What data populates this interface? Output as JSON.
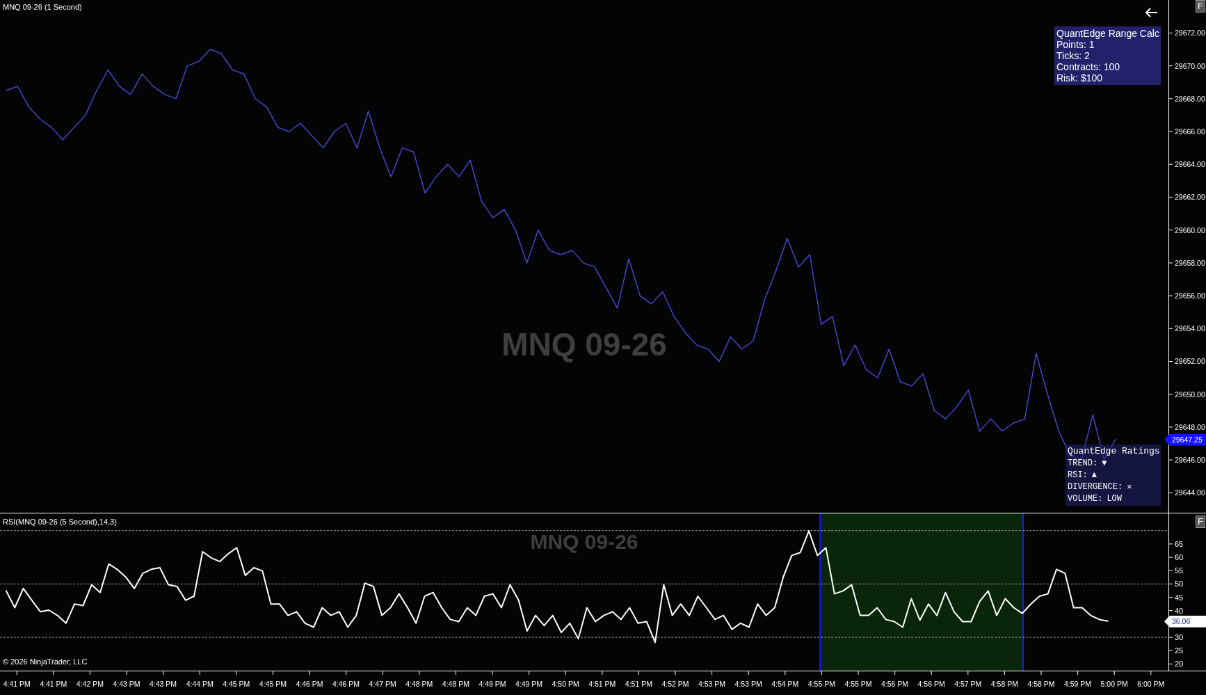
{
  "price_panel": {
    "title": "MNQ 09-26 (1 Second)",
    "watermark": "MNQ 09-26",
    "corner_button": "F",
    "current_price": "29647.25",
    "range_calc": {
      "title": "QuantEdge Range Calc",
      "lines": [
        "Points: 1",
        "Ticks: 2",
        "Contracts: 100",
        "Risk: $100"
      ]
    },
    "ratings": {
      "title": "QuantEdge Ratings",
      "rows": [
        {
          "label": "TREND:",
          "value": "▼"
        },
        {
          "label": "RSI:",
          "value": "▲"
        },
        {
          "label": "DIVERGENCE:",
          "value": "✕"
        },
        {
          "label": "VOLUME:",
          "value": "LOW"
        }
      ]
    },
    "chart_data": {
      "type": "line",
      "ylim": [
        29642.74,
        29674.01
      ],
      "categories": [
        null,
        null,
        null,
        null,
        null,
        null,
        null,
        null,
        null,
        null,
        null,
        null,
        null,
        null,
        null,
        null,
        null,
        null,
        null,
        null,
        null,
        null,
        null,
        null,
        null,
        null,
        null,
        null,
        null,
        null,
        null,
        null,
        null,
        null,
        null,
        null,
        null,
        null,
        null,
        null,
        null,
        null,
        null,
        null,
        null,
        null,
        null,
        null,
        null,
        null,
        null,
        null,
        null,
        null,
        null,
        null,
        null,
        null,
        null,
        null,
        null,
        null,
        null,
        null,
        null,
        null,
        null,
        null,
        null,
        null,
        null,
        null,
        null,
        null,
        null,
        null,
        null,
        null,
        null,
        null,
        null,
        null,
        null,
        null,
        null,
        null,
        null,
        null,
        null,
        null,
        null,
        null,
        null,
        null,
        null,
        null,
        null,
        null,
        null
      ],
      "series": [
        {
          "color": "#4b48d6",
          "values": [
            29668.5,
            29668.75,
            29667.5,
            29666.75,
            29666.25,
            29665.5,
            29666.25,
            29667,
            29668.5,
            29669.75,
            29668.75,
            29668.25,
            29669.5,
            29668.75,
            29668.25,
            29668,
            29670,
            29670.25,
            29671,
            29670.75,
            29669.75,
            29669.5,
            29668,
            29667.5,
            29666.25,
            29666,
            29666.5,
            29665.75,
            29665,
            29666,
            29666.5,
            29665,
            29667.25,
            29665,
            29663.25,
            29665,
            29664.75,
            29662.25,
            29663.25,
            29664,
            29663.25,
            29664.25,
            29661.75,
            29660.75,
            29661.25,
            29660,
            29658,
            29660,
            29658.75,
            29658.5,
            29658.75,
            29658,
            29657.75,
            29656.5,
            29655.25,
            29658.25,
            29656,
            29655.5,
            29656.25,
            29654.75,
            29653.75,
            29653,
            29652.75,
            29652,
            29653.5,
            29652.75,
            29653.25,
            29655.75,
            29657.5,
            29659.5,
            29657.75,
            29658.5,
            29654.25,
            29654.75,
            29651.75,
            29653,
            29651.5,
            29651,
            29652.75,
            29650.75,
            29650.5,
            29651.25,
            29649,
            29648.5,
            29649.25,
            29650.25,
            29647.75,
            29648.5,
            29647.75,
            29648.25,
            29648.5,
            29652.5,
            29650,
            29647.75,
            29646.25,
            29646,
            29648.75,
            29646,
            29647.25
          ]
        }
      ],
      "yticks": [
        {
          "value": 29672,
          "label": "29672.00"
        },
        {
          "value": 29670,
          "label": "29670.00"
        },
        {
          "value": 29668,
          "label": "29668.00"
        },
        {
          "value": 29666,
          "label": "29666.00"
        },
        {
          "value": 29664,
          "label": "29664.00"
        },
        {
          "value": 29662,
          "label": "29662.00"
        },
        {
          "value": 29660,
          "label": "29660.00"
        },
        {
          "value": 29658,
          "label": "29658.00"
        },
        {
          "value": 29656,
          "label": "29656.00"
        },
        {
          "value": 29654,
          "label": "29654.00"
        },
        {
          "value": 29652,
          "label": "29652.00"
        },
        {
          "value": 29650,
          "label": "29650.00"
        },
        {
          "value": 29648,
          "label": "29648.00"
        },
        {
          "value": 29646,
          "label": "29646.00"
        },
        {
          "value": 29644,
          "label": "29644.00"
        }
      ]
    }
  },
  "rsi_panel": {
    "title": "RSI(MNQ 09-26 (5 Second),14,3)",
    "watermark": "MNQ 09-26",
    "corner_button": "F",
    "current_value": "36.06",
    "copyright": "© 2026 NinjaTrader, LLC",
    "chart_data": {
      "type": "line",
      "ylim": [
        17.24,
        76.45
      ],
      "categories": [
        null,
        null,
        null,
        null,
        null,
        null,
        null,
        null,
        null,
        null,
        null,
        null,
        null,
        null,
        null,
        null,
        null,
        null,
        null,
        null,
        null,
        null,
        null,
        null,
        null,
        null,
        null,
        null,
        null,
        null,
        null,
        null,
        null,
        null,
        null,
        null,
        null,
        null,
        null,
        null,
        null,
        null,
        null,
        null,
        null,
        null,
        null,
        null,
        null,
        null,
        null,
        null,
        null,
        null,
        null,
        null,
        null,
        null,
        null,
        null,
        null,
        null,
        null,
        null,
        null,
        null,
        null,
        null,
        null,
        null,
        null,
        null,
        null,
        null,
        null,
        null,
        null,
        null,
        null,
        null,
        null,
        null,
        null,
        null,
        null,
        null,
        null,
        null,
        null,
        null,
        null,
        null,
        null,
        null,
        null,
        null,
        null,
        null,
        null,
        null,
        null,
        null,
        null,
        null,
        null,
        null,
        null,
        null,
        null,
        null,
        null,
        null,
        null,
        null,
        null,
        null,
        null,
        null,
        null,
        null,
        null,
        null,
        null,
        null,
        null,
        null,
        null,
        null,
        null,
        null
      ],
      "series": [
        {
          "color": "#ffffff",
          "values": [
            47.4,
            41.1,
            48.3,
            43.9,
            39.6,
            40.2,
            38.2,
            35.3,
            42.5,
            41.9,
            49.7,
            46.8,
            57.5,
            55.5,
            52.6,
            48.3,
            54,
            55.5,
            56.1,
            49.7,
            49.1,
            43.9,
            45.4,
            62.1,
            59.8,
            58.4,
            61.3,
            63.6,
            53.2,
            56.1,
            54.9,
            42.5,
            42.5,
            38.2,
            39.6,
            35.3,
            33.8,
            41.1,
            38.2,
            39.6,
            33.8,
            38.2,
            50.3,
            49.1,
            38.2,
            41.1,
            46.3,
            41.1,
            35.3,
            45.4,
            46.8,
            41.1,
            36.7,
            35.9,
            41.1,
            38.2,
            45.4,
            46.3,
            41.1,
            49.7,
            43.9,
            32.4,
            38.2,
            34.4,
            38.2,
            31.8,
            35.3,
            29.5,
            41.1,
            35.9,
            38.2,
            39.6,
            36.7,
            41.1,
            35.3,
            35.9,
            28.1,
            49.7,
            38.2,
            42.5,
            38.2,
            45.4,
            41.1,
            36.7,
            38.2,
            33,
            35.3,
            33.8,
            42.5,
            38.2,
            41.1,
            52.6,
            60.7,
            61.8,
            69.9,
            60.7,
            63.6,
            46.3,
            47.4,
            49.7,
            38.2,
            38.2,
            41.1,
            36.7,
            35.9,
            33.8,
            44.5,
            36.4,
            42.5,
            38.2,
            46.8,
            39.6,
            35.9,
            35.9,
            43.4,
            47.4,
            38.2,
            44.5,
            41.1,
            39,
            42.5,
            45.4,
            46.3,
            55.5,
            54,
            41.1,
            41.1,
            38.2,
            36.7,
            36.1
          ]
        }
      ],
      "yticks": [
        65,
        60,
        55,
        50,
        45,
        40,
        30,
        25,
        20
      ]
    }
  },
  "time_axis": [
    "4:41 PM",
    "4:41 PM",
    "4:42 PM",
    "4:43 PM",
    "4:43 PM",
    "4:44 PM",
    "4:45 PM",
    "4:45 PM",
    "4:46 PM",
    "4:46 PM",
    "4:47 PM",
    "4:48 PM",
    "4:48 PM",
    "4:49 PM",
    "4:49 PM",
    "4:50 PM",
    "4:51 PM",
    "4:51 PM",
    "4:52 PM",
    "4:53 PM",
    "4:53 PM",
    "4:54 PM",
    "4:55 PM",
    "4:55 PM",
    "4:56 PM",
    "4:56 PM",
    "4:57 PM",
    "4:58 PM",
    "4:58 PM",
    "4:59 PM",
    "5:00 PM",
    "6:00 PM"
  ]
}
